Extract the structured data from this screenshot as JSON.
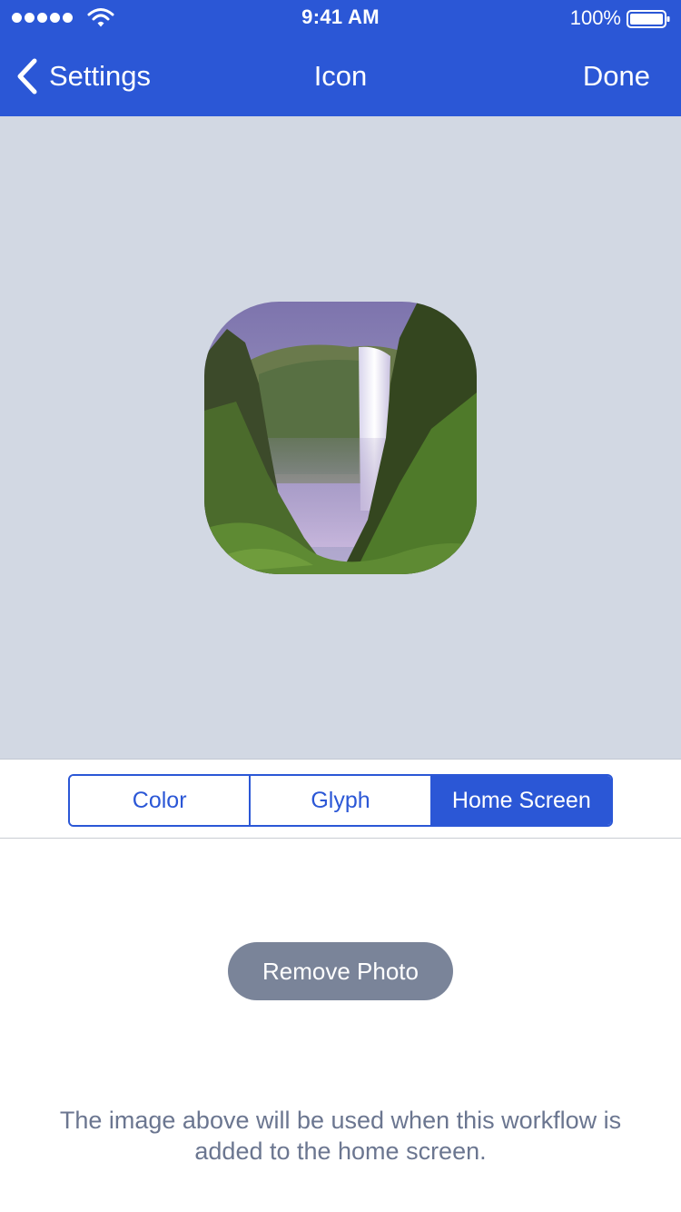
{
  "status_bar": {
    "time": "9:41 AM",
    "battery_percent": "100%",
    "signal_bars": 5,
    "icons": [
      "signal-icon",
      "wifi-icon",
      "battery-icon"
    ]
  },
  "nav": {
    "back_label": "Settings",
    "title": "Icon",
    "done_label": "Done",
    "icons": [
      "chevron-left-icon"
    ]
  },
  "preview": {
    "icon_image": "waterfall-photo"
  },
  "segmented_control": {
    "segments": [
      "Color",
      "Glyph",
      "Home Screen"
    ],
    "selected": "Home Screen"
  },
  "remove_button_label": "Remove Photo",
  "footnote": "The image above will be used when this workflow is added to the home screen.",
  "colors": {
    "accent": "#2b57d6",
    "preview_background": "#d2d8e3",
    "remove_button": "#7a8499",
    "footnote_text": "#6b7690"
  }
}
